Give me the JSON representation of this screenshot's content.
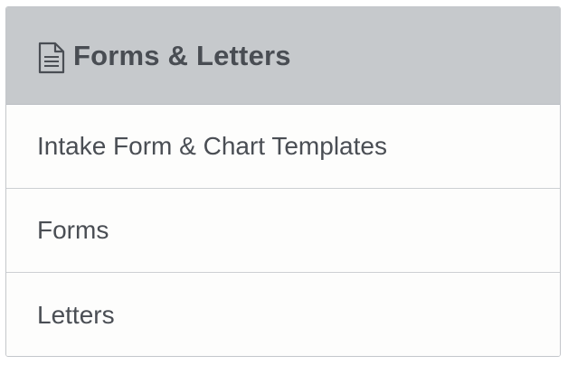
{
  "panel": {
    "title": "Forms & Letters",
    "icon": "document-icon",
    "header_color": "#c6c9cc",
    "text_color": "#494d53"
  },
  "items": [
    {
      "label": "Intake Form & Chart Templates"
    },
    {
      "label": "Forms"
    },
    {
      "label": "Letters"
    }
  ]
}
